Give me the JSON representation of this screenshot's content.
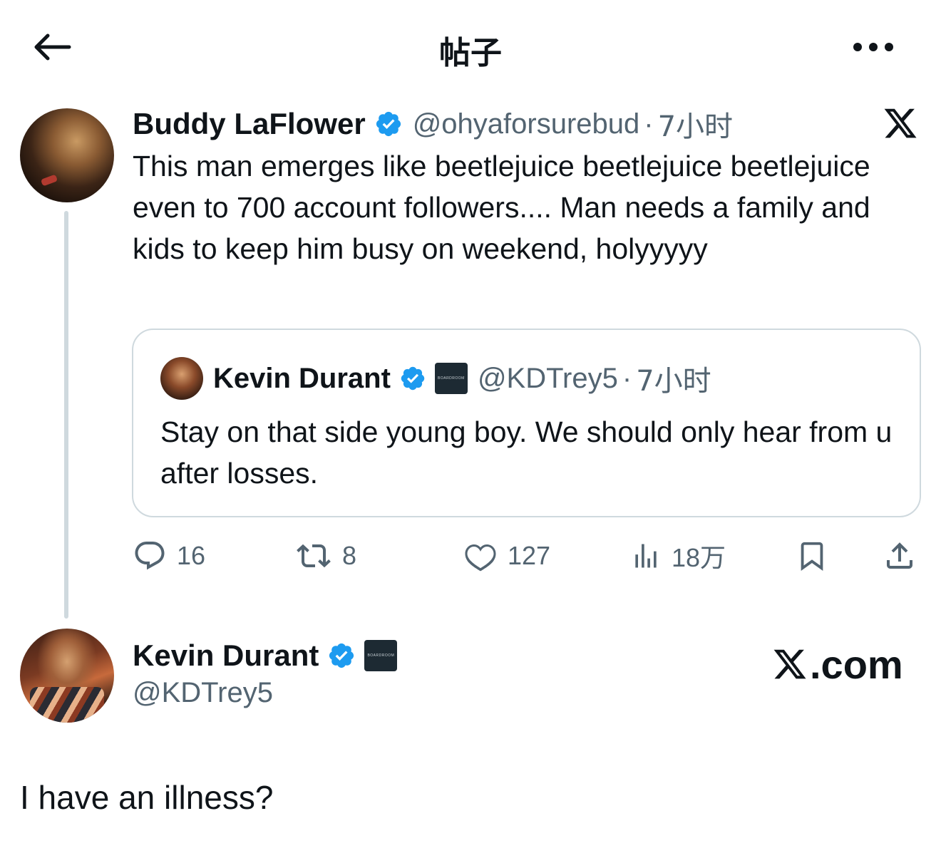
{
  "header": {
    "title": "帖子",
    "back_icon": "arrow-left-icon",
    "more_icon": "more-horizontal-icon"
  },
  "parent_tweet": {
    "author_name": "Buddy LaFlower",
    "handle": "@ohyaforsurebud",
    "separator": "·",
    "time": "7小时",
    "text": "This man emerges like beetlejuice beetlejuice beetlejuice even to 700 account followers.... Man needs a family and kids to keep him busy on weekend, holyyyyy",
    "quote": {
      "author_name": "Kevin Durant",
      "affiliate_badge": "BOARDROOM",
      "handle": "@KDTrey5",
      "separator": "·",
      "time": "7小时",
      "text": "Stay on that side young boy. We should only hear from u after losses."
    },
    "actions": {
      "replies": "16",
      "reposts": "8",
      "likes": "127",
      "views": "18万"
    }
  },
  "reply_tweet": {
    "author_name": "Kevin Durant",
    "affiliate_badge": "BOARDROOM",
    "handle": "@KDTrey5",
    "brand": ".com",
    "text": "I have an illness?"
  },
  "colors": {
    "text_primary": "#0f1419",
    "text_secondary": "#536471",
    "verified_blue": "#1d9bf0",
    "border": "#cfd9de"
  }
}
